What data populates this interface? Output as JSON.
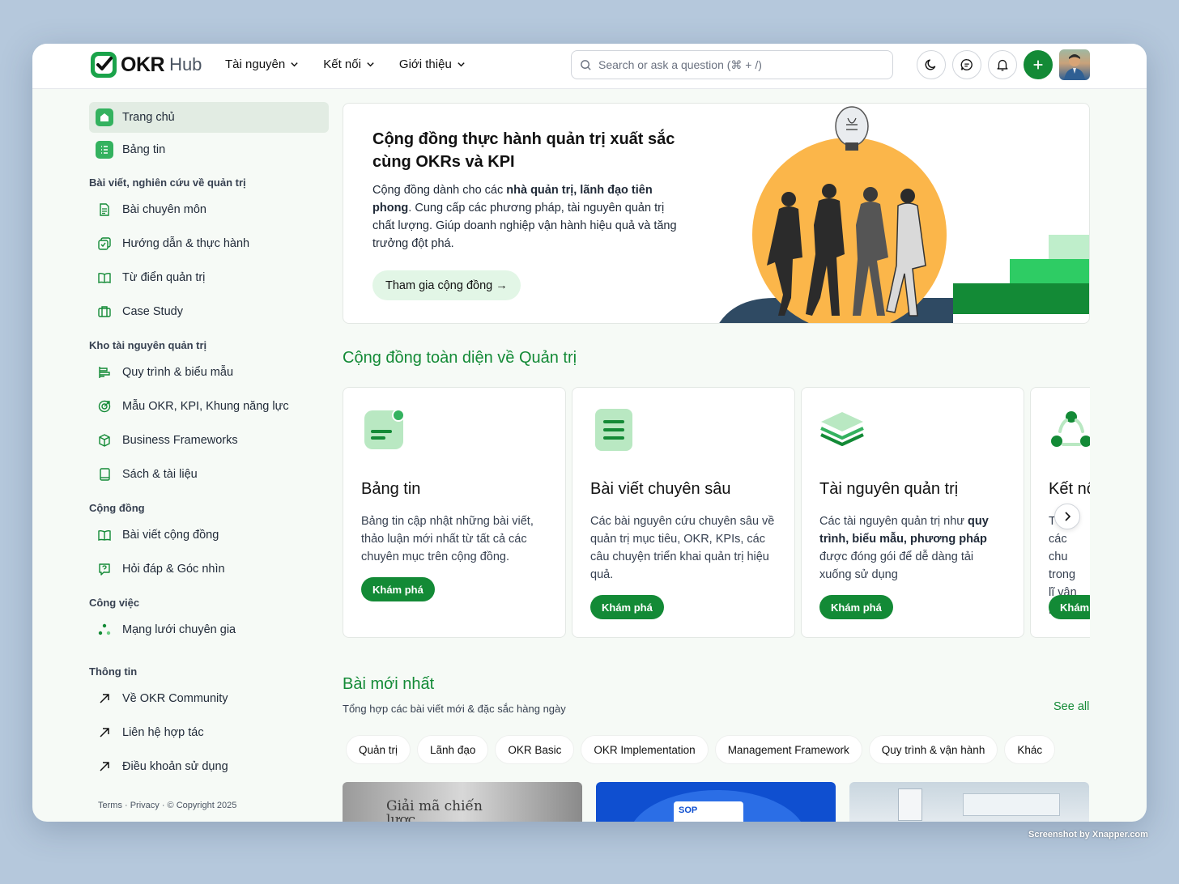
{
  "header": {
    "brand": "OKR",
    "brand_sub": "Hub",
    "nav": [
      "Tài nguyên",
      "Kết nối",
      "Giới thiệu"
    ],
    "search_placeholder": "Search or ask a question (⌘ + /)",
    "icons": [
      "moon-icon",
      "chat-icon",
      "bell-icon",
      "plus-icon"
    ],
    "accent": "#138a36"
  },
  "sidebar": {
    "top_items": [
      {
        "label": "Trang chủ",
        "icon": "home-icon"
      },
      {
        "label": "Bảng tin",
        "icon": "list-icon"
      }
    ],
    "groups": [
      {
        "heading": "Bài viết, nghiên cứu về quản trị",
        "items": [
          {
            "label": "Bài chuyên môn",
            "icon": "document-icon"
          },
          {
            "label": "Hướng dẫn & thực hành",
            "icon": "checklist-icon"
          },
          {
            "label": "Từ điển quản trị",
            "icon": "book-open-icon"
          },
          {
            "label": "Case Study",
            "icon": "briefcase-icon"
          }
        ]
      },
      {
        "heading": "Kho tài nguyên quản trị",
        "items": [
          {
            "label": "Quy trình & biểu mẫu",
            "icon": "flow-icon"
          },
          {
            "label": "Mẫu OKR, KPI, Khung năng lực",
            "icon": "target-icon"
          },
          {
            "label": "Business Frameworks",
            "icon": "cube-icon"
          },
          {
            "label": "Sách & tài liệu",
            "icon": "book-icon"
          }
        ]
      },
      {
        "heading": "Cộng đồng",
        "items": [
          {
            "label": "Bài viết cộng đồng",
            "icon": "book-open-icon"
          },
          {
            "label": "Hỏi đáp & Góc nhìn",
            "icon": "question-icon"
          }
        ]
      },
      {
        "heading": "Công việc",
        "items": [
          {
            "label": "Mạng lưới chuyên gia",
            "icon": "network-icon"
          }
        ]
      },
      {
        "heading": "Thông tin",
        "items": [
          {
            "label": "Về OKR Community",
            "icon": "arrow-up-right-icon"
          },
          {
            "label": "Liên hệ hợp tác",
            "icon": "arrow-up-right-icon"
          },
          {
            "label": "Điều khoản sử dụng",
            "icon": "arrow-up-right-icon"
          }
        ]
      }
    ],
    "footer": "Terms · Privacy · © Copyright 2025"
  },
  "hero": {
    "title": "Cộng đồng thực hành quản trị xuất sắc cùng OKRs và KPI",
    "desc_1": "Cộng đồng dành cho các ",
    "desc_bold": "nhà quản trị, lãnh đạo tiên phong",
    "desc_2": ". Cung cấp các phương pháp, tài nguyên quản trị chất lượng. Giúp doanh nghiệp vận hành hiệu quả và tăng trưởng đột phá.",
    "cta": "Tham gia cộng đồng →"
  },
  "community": {
    "title": "Cộng đồng toàn diện về Quản trị",
    "cards": [
      {
        "title": "Bảng tin",
        "desc": "Bảng tin cập nhật những bài viết, thảo luận mới nhất từ tất cả các chuyên mục trên cộng đồng.",
        "button": "Khám phá",
        "icon": "newsfeed-icon"
      },
      {
        "title": "Bài viết chuyên sâu",
        "desc": "Các bài nguyên cứu chuyên sâu về quản trị mục tiêu, OKR, KPIs, các câu chuyện triển khai quản trị hiệu quả.",
        "button": "Khám phá",
        "icon": "article-icon"
      },
      {
        "title": "Tài nguyên quản trị",
        "desc_1": "Các tài nguyên quản trị như ",
        "desc_bold": "quy trình, biểu mẫu, phương pháp",
        "desc_2": " được đóng gói để dễ dàng tải xuống sử dụng",
        "button": "Khám phá",
        "icon": "layers-icon"
      },
      {
        "title": "Kết nố",
        "desc": "T  đổ các chu trong lĩ vận hàn",
        "button": "Khám",
        "icon": "network-icon"
      }
    ]
  },
  "latest": {
    "title": "Bài mới nhất",
    "subtitle": "Tổng hợp các bài viết mới & đặc sắc hàng ngày",
    "see_all": "See all",
    "tags": [
      "Quản trị",
      "Lãnh đạo",
      "OKR Basic",
      "OKR Implementation",
      "Management Framework",
      "Quy trình & vận hành",
      "Khác"
    ],
    "thumb_1_text": "Giải mã chiến lược",
    "thumb_2_text": "SOP"
  },
  "watermark": "Screenshot by Xnapper.com"
}
